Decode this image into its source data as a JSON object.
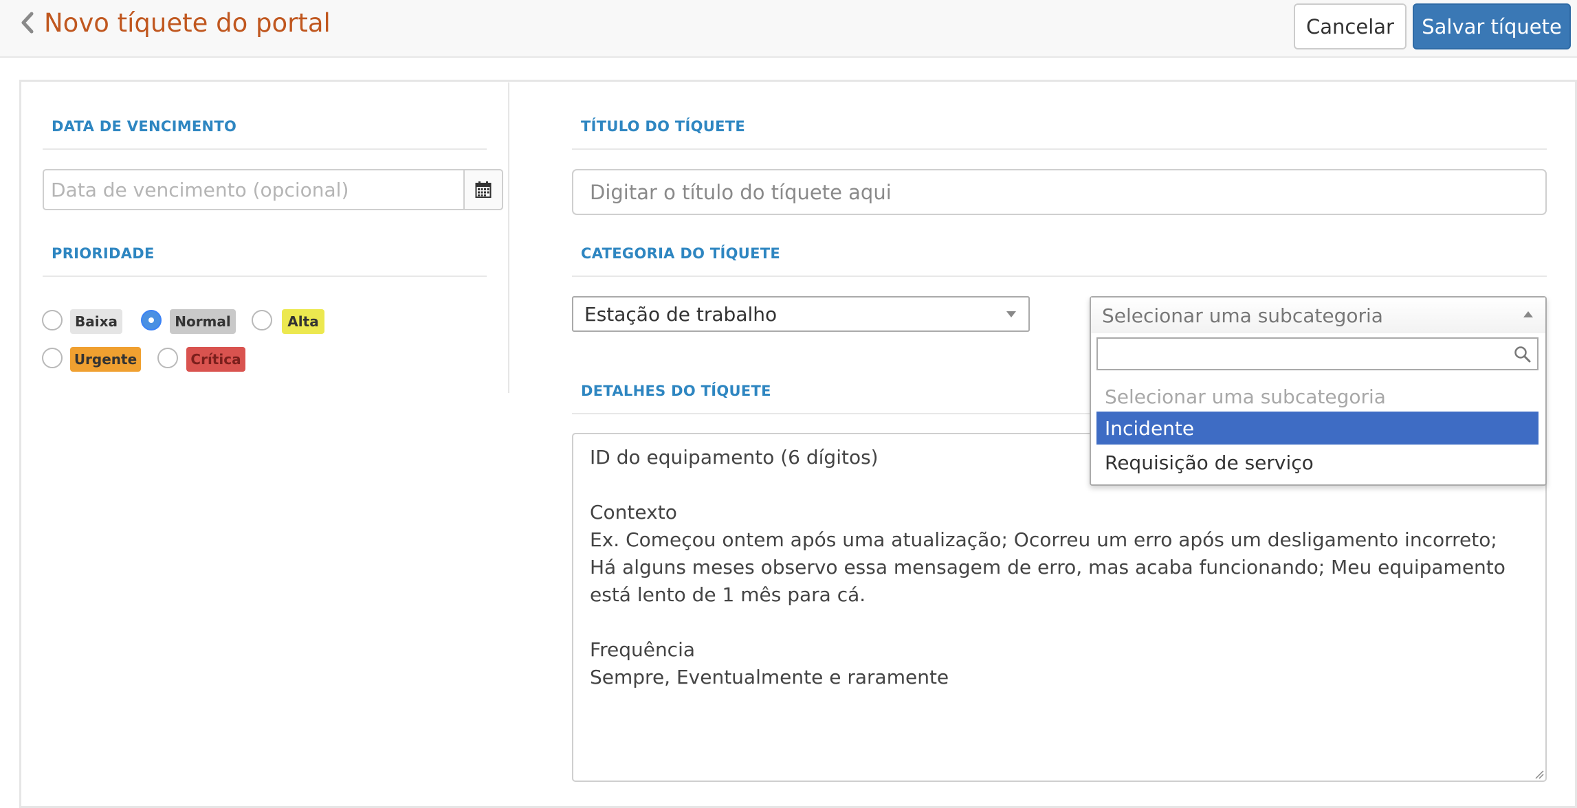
{
  "header": {
    "title": "Novo tíquete do portal",
    "cancel_label": "Cancelar",
    "save_label": "Salvar tíquete"
  },
  "due_date": {
    "section_title": "DATA DE VENCIMENTO",
    "placeholder": "Data de vencimento (opcional)",
    "calendar_icon": "calendar-icon"
  },
  "priority": {
    "section_title": "PRIORIDADE",
    "selected": "Normal",
    "options": [
      {
        "label": "Baixa",
        "color": "#e5e5e5",
        "text_color": "#333333"
      },
      {
        "label": "Normal",
        "color": "#c9c9c9",
        "text_color": "#333333"
      },
      {
        "label": "Alta",
        "color": "#ece84f",
        "text_color": "#333333"
      },
      {
        "label": "Urgente",
        "color": "#f0a030",
        "text_color": "#333333"
      },
      {
        "label": "Crítica",
        "color": "#d9534f",
        "text_color": "#7a1f1c"
      }
    ]
  },
  "ticket_title": {
    "section_title": "TÍTULO DO TÍQUETE",
    "placeholder": "Digitar o título do tíquete aqui"
  },
  "category": {
    "section_title": "CATEGORIA DO TÍQUETE",
    "selected": "Estação de trabalho",
    "subcategory": {
      "placeholder": "Selecionar uma subcategoria",
      "search_value": "",
      "options": [
        {
          "label": "Selecionar uma subcategoria",
          "state": "disabled"
        },
        {
          "label": "Incidente",
          "state": "highlighted"
        },
        {
          "label": "Requisição de serviço",
          "state": "normal"
        }
      ]
    }
  },
  "details": {
    "section_title": "DETALHES DO TÍQUETE",
    "lines": [
      "ID do equipamento (6 dígitos)",
      "",
      "Contexto",
      "Ex. Começou ontem após uma atualização; Ocorreu um erro após um desligamento incorreto; Há alguns meses observo essa mensagem de erro, mas acaba funcionando; Meu equipamento está lento de 1 mês para cá.",
      "",
      "Frequência",
      "Sempre, Eventualmente e raramente"
    ]
  },
  "colors": {
    "accent": "#3a78b5",
    "title_orange": "#c0571f",
    "section_blue": "#2e86c1",
    "highlight": "#3e6cc4"
  }
}
